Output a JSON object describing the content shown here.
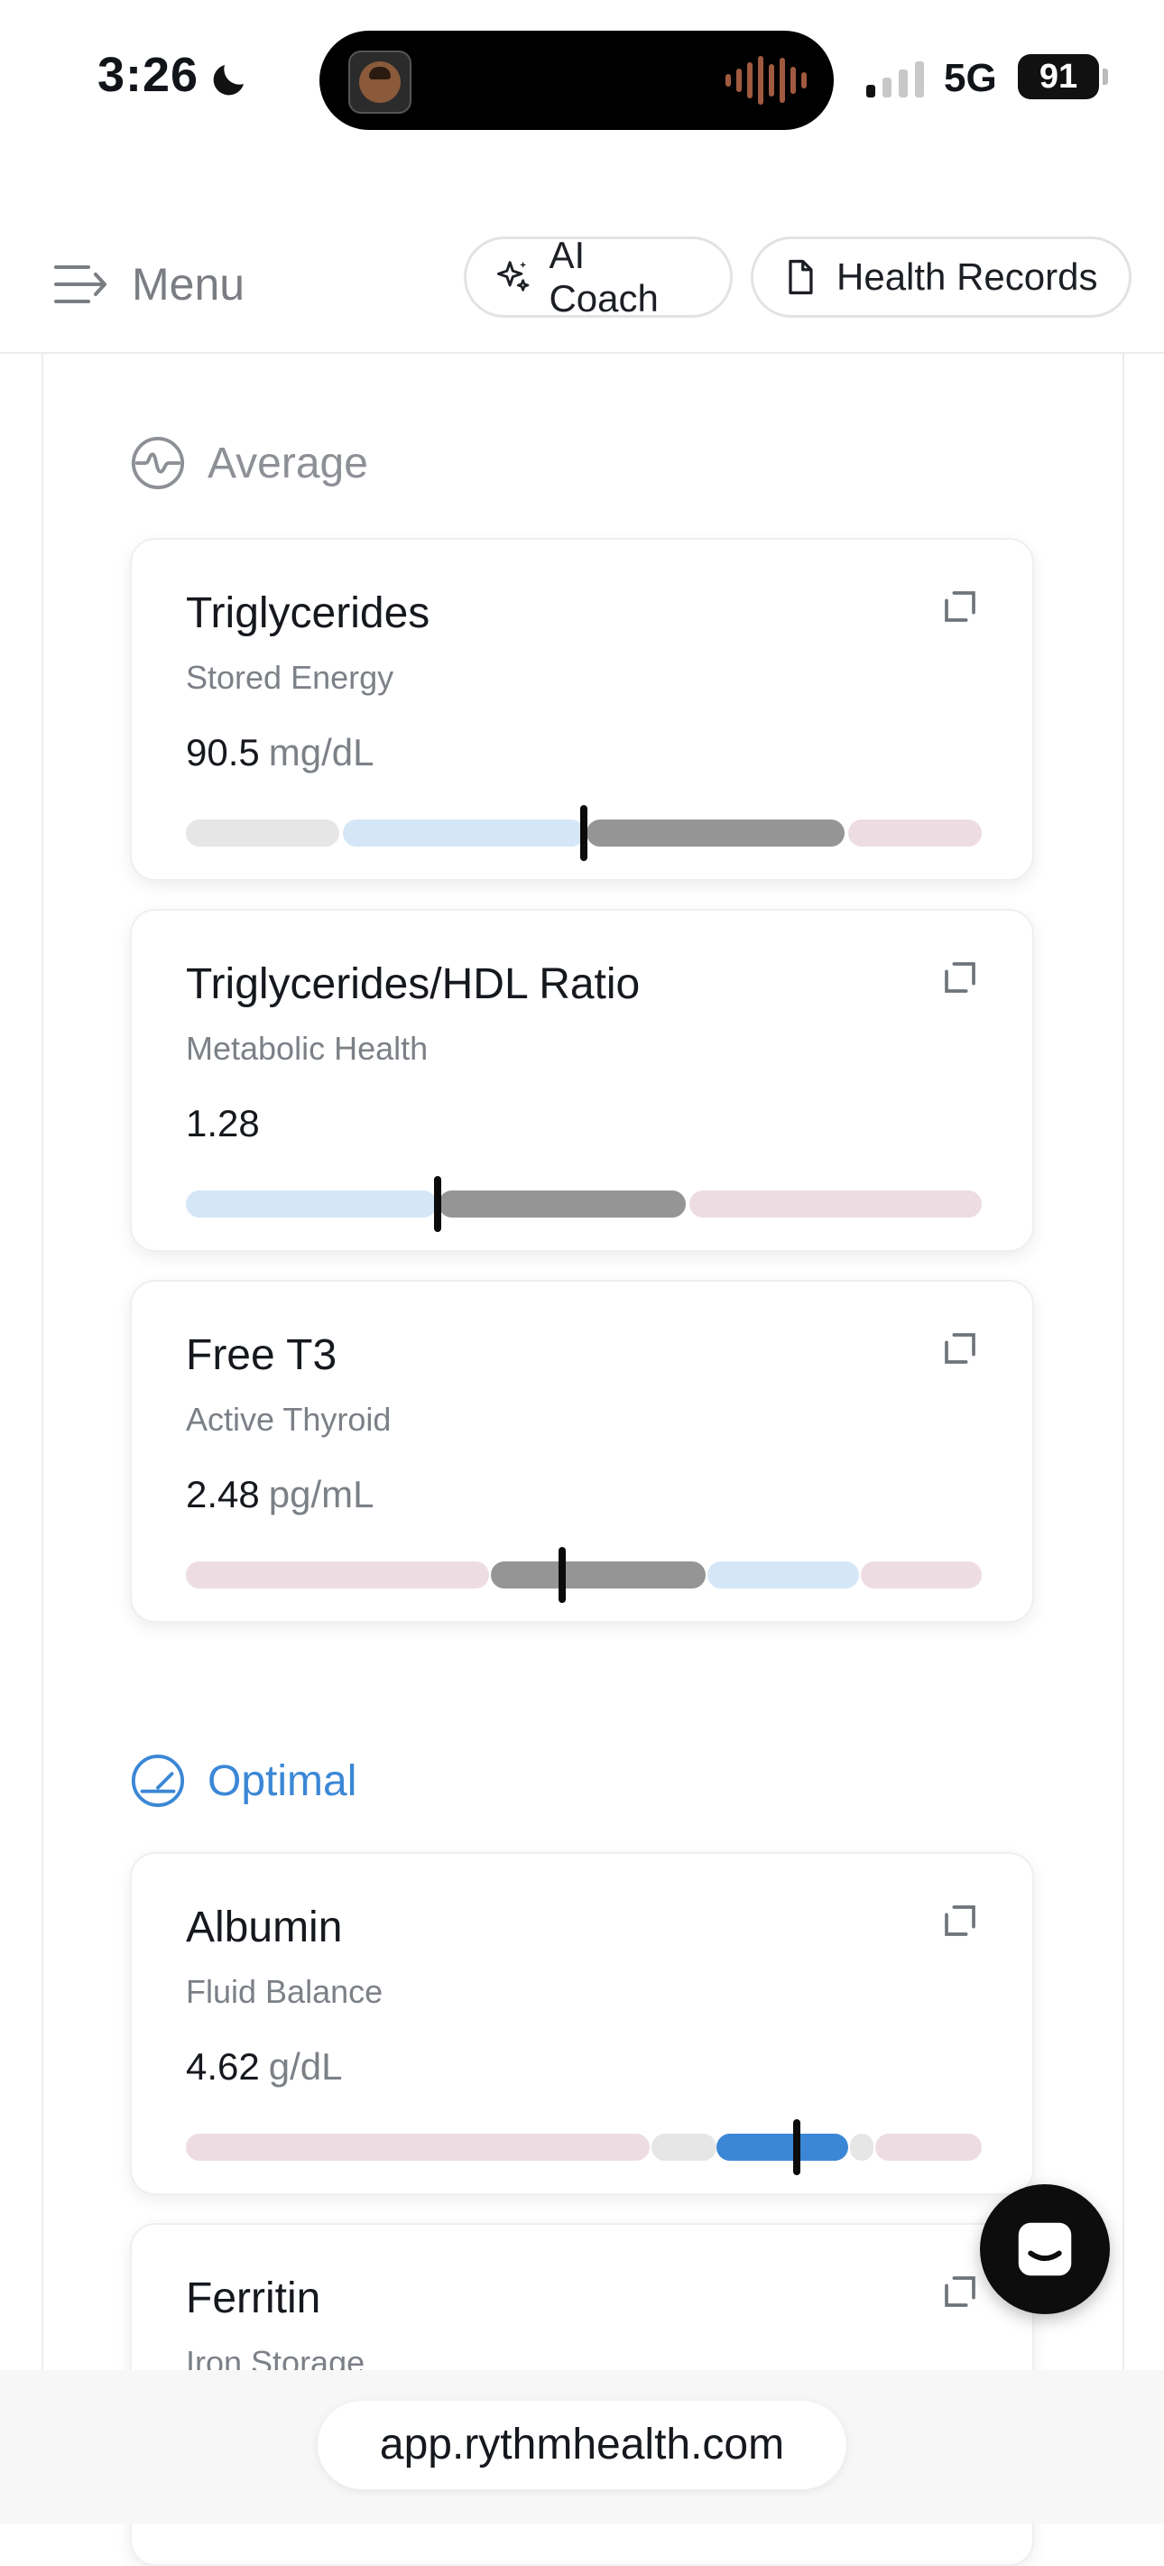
{
  "status_bar": {
    "time": "3:26",
    "network": "5G",
    "battery": "91",
    "icons": [
      "moon-icon",
      "signal-icon",
      "battery-icon"
    ]
  },
  "nav": {
    "menu_label": "Menu",
    "ai_coach_label": "AI Coach",
    "health_records_label": "Health Records",
    "icons": [
      "menu-icon",
      "sparkle-icon",
      "document-icon"
    ]
  },
  "sections": {
    "average": {
      "label": "Average",
      "icon": "wave-circle-icon",
      "color": "#8d9096"
    },
    "optimal": {
      "label": "Optimal",
      "icon": "gauge-icon",
      "color": "#3b87d6"
    }
  },
  "biomarkers": [
    {
      "name": "Triglycerides",
      "category": "Stored Energy",
      "value": "90.5",
      "unit": "mg/dL",
      "status": "Average",
      "marker_position": 0.5
    },
    {
      "name": "Triglycerides/HDL Ratio",
      "category": "Metabolic Health",
      "value": "1.28",
      "unit": "",
      "status": "Average",
      "marker_position": 0.316
    },
    {
      "name": "Free T3",
      "category": "Active Thyroid",
      "value": "2.48",
      "unit": "pg/mL",
      "status": "Average",
      "marker_position": 0.473
    },
    {
      "name": "Albumin",
      "category": "Fluid Balance",
      "value": "4.62",
      "unit": "g/dL",
      "status": "Optimal",
      "marker_position": 0.767
    },
    {
      "name": "Ferritin",
      "category": "Iron Storage",
      "value": "",
      "unit": "",
      "status": "Optimal"
    }
  ],
  "colors": {
    "range_gray_light": "#e6e6e6",
    "range_blue_light": "#d5e7f7",
    "range_gray_active": "#959595",
    "range_pink": "#eddde3",
    "range_blue_active": "#3b87d6"
  },
  "browser": {
    "url": "app.rythmhealth.com"
  },
  "chat": {
    "icon": "chat-icon"
  }
}
